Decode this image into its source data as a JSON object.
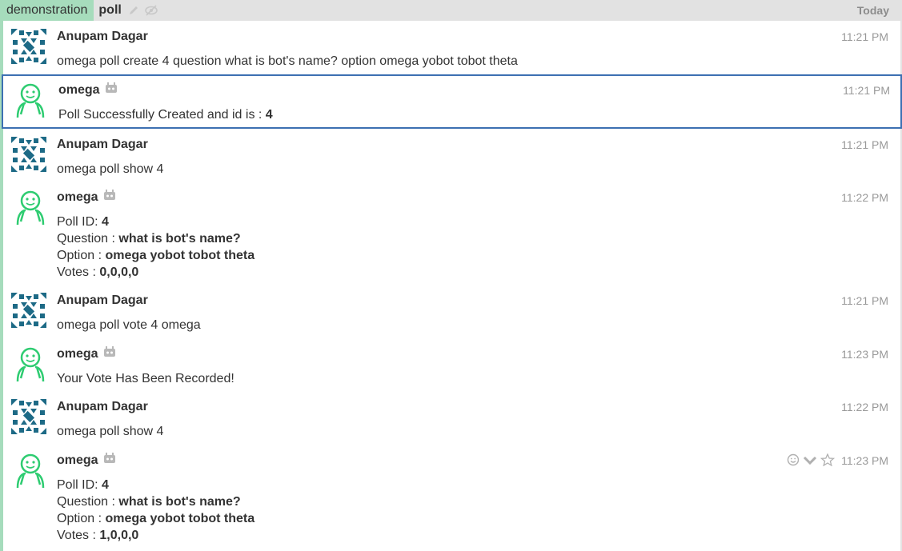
{
  "header": {
    "stream": "demonstration",
    "topic": "poll",
    "date": "Today"
  },
  "messages": [
    {
      "sender": "Anupam Dagar",
      "time": "11:21 PM",
      "text": "omega poll create 4 question what is bot's name? option omega yobot tobot theta"
    },
    {
      "sender": "omega",
      "time": "11:21 PM",
      "text": "Poll Successfully Created and id is : ",
      "bold": "4"
    },
    {
      "sender": "Anupam Dagar",
      "time": "11:21 PM",
      "text": "omega poll show 4"
    },
    {
      "sender": "omega",
      "time": "11:22 PM",
      "lines": [
        {
          "label": "Poll ID: ",
          "value": "4"
        },
        {
          "label": "Question : ",
          "value": "what is bot's name?"
        },
        {
          "label": "Option : ",
          "value": "omega yobot tobot theta"
        },
        {
          "label": "Votes : ",
          "value": "0,0,0,0"
        }
      ]
    },
    {
      "sender": "Anupam Dagar",
      "time": "11:21 PM",
      "text": "omega poll vote 4 omega"
    },
    {
      "sender": "omega",
      "time": "11:23 PM",
      "text": "Your Vote Has Been Recorded!"
    },
    {
      "sender": "Anupam Dagar",
      "time": "11:22 PM",
      "text": "omega poll show 4"
    },
    {
      "sender": "omega",
      "time": "11:23 PM",
      "lines": [
        {
          "label": "Poll ID: ",
          "value": "4"
        },
        {
          "label": "Question : ",
          "value": "what is bot's name?"
        },
        {
          "label": "Option : ",
          "value": "omega yobot tobot theta"
        },
        {
          "label": "Votes : ",
          "value": "1,0,0,0"
        }
      ]
    }
  ],
  "icons": {
    "edit_topic": "pencil-icon",
    "mute_topic": "eye-slash-icon",
    "bot_badge": "bot-icon",
    "emoji": "smile-icon",
    "more": "chevron-down-icon",
    "star": "star-icon"
  },
  "colors": {
    "stream": "#a6dcbc",
    "selected_border": "#3d70b2",
    "bot_avatar": "#2ecc71",
    "user_avatar": "#1d6a86"
  }
}
